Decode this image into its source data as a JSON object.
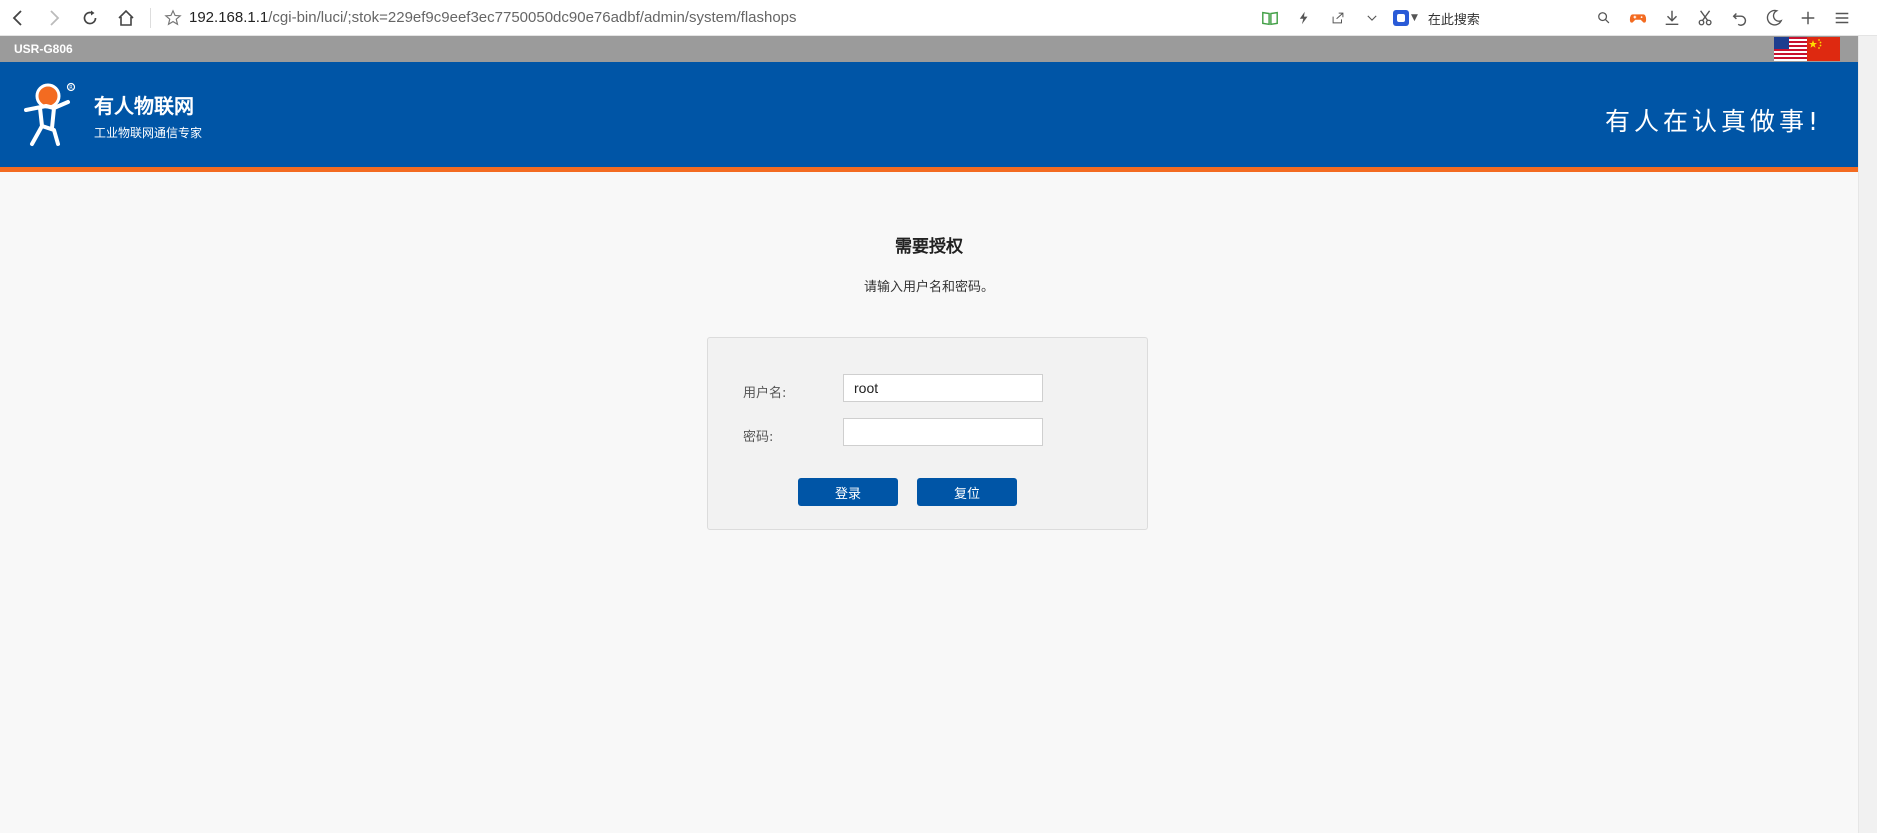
{
  "browser": {
    "url_host": "192.168.1.1",
    "url_path": "/cgi-bin/luci/;stok=229ef9c9eef3ec7750050dc90e76adbf/admin/system/flashops",
    "search_placeholder": "在此搜索"
  },
  "router": {
    "model": "USR-G806",
    "brand_name": "有人物联网",
    "brand_sub": "工业物联网通信专家",
    "slogan": "有人在认真做事!",
    "colors": {
      "header_blue": "#0055a6",
      "accent_orange": "#f36b21",
      "strip_gray": "#9b9b9b"
    }
  },
  "auth": {
    "title": "需要授权",
    "description": "请输入用户名和密码。",
    "username_label": "用户名:",
    "username_value": "root",
    "password_label": "密码:",
    "password_value": "",
    "login_label": "登录",
    "reset_label": "复位"
  }
}
